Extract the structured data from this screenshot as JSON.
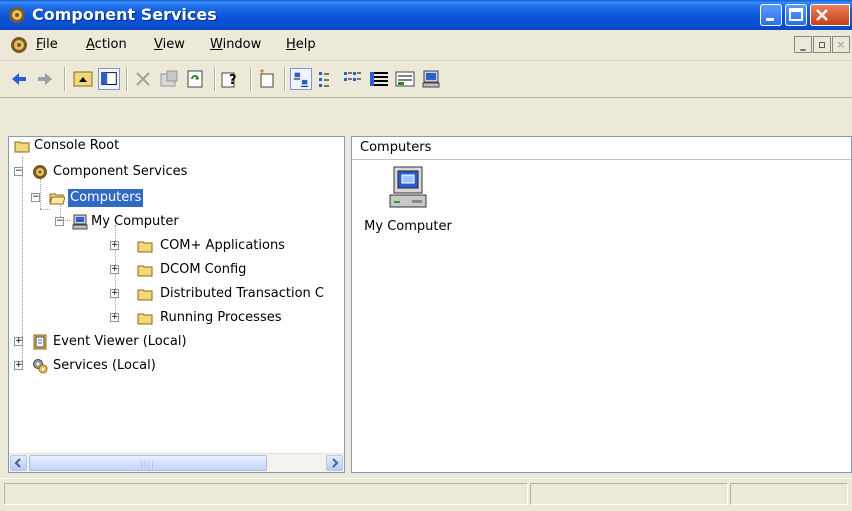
{
  "window": {
    "title": "Component Services",
    "icons": {
      "app": "component-services-icon",
      "minimize": "minimize-icon",
      "maximize": "maximize-icon",
      "close": "close-icon"
    }
  },
  "menubar": {
    "items": [
      {
        "first": "F",
        "rest": "ile"
      },
      {
        "first": "A",
        "rest": "ction"
      },
      {
        "first": "V",
        "rest": "iew"
      },
      {
        "first": "W",
        "rest": "indow"
      },
      {
        "first": "H",
        "rest": "elp"
      }
    ],
    "mdi": {
      "minimize": "_",
      "restore": "▫",
      "close": "×"
    }
  },
  "toolbar": {
    "icons": [
      "back-arrow-icon",
      "forward-arrow-icon",
      "up-folder-icon",
      "show-hide-console-tree-icon",
      "delete-icon",
      "properties-icon",
      "refresh-icon",
      "help-icon",
      "new-window-icon",
      "large-icons-view-icon",
      "small-icons-view-icon",
      "list-view-icon",
      "details-view-icon",
      "status-view-icon",
      "my-computer-toolbar-icon"
    ]
  },
  "tree": {
    "nodes": [
      {
        "label": "Console Root",
        "icon": "folder-icon"
      },
      {
        "label": "Component Services",
        "icon": "component-services-icon"
      },
      {
        "label": "Computers",
        "icon": "open-folder-icon",
        "selected": true
      },
      {
        "label": "My Computer",
        "icon": "computer-icon"
      },
      {
        "label": "COM+ Applications",
        "icon": "folder-icon"
      },
      {
        "label": "DCOM Config",
        "icon": "folder-icon"
      },
      {
        "label": "Distributed Transaction C",
        "icon": "folder-icon"
      },
      {
        "label": "Running Processes",
        "icon": "folder-icon"
      },
      {
        "label": "Event Viewer (Local)",
        "icon": "event-viewer-icon"
      },
      {
        "label": "Services (Local)",
        "icon": "services-gears-icon"
      }
    ]
  },
  "right_pane": {
    "header": "Computers",
    "items": [
      {
        "label": "My Computer",
        "icon": "my-computer-large-icon"
      }
    ]
  },
  "colors": {
    "titlebar": "#0a5fd8",
    "selection": "#316ac5",
    "chrome": "#ece9d8"
  }
}
